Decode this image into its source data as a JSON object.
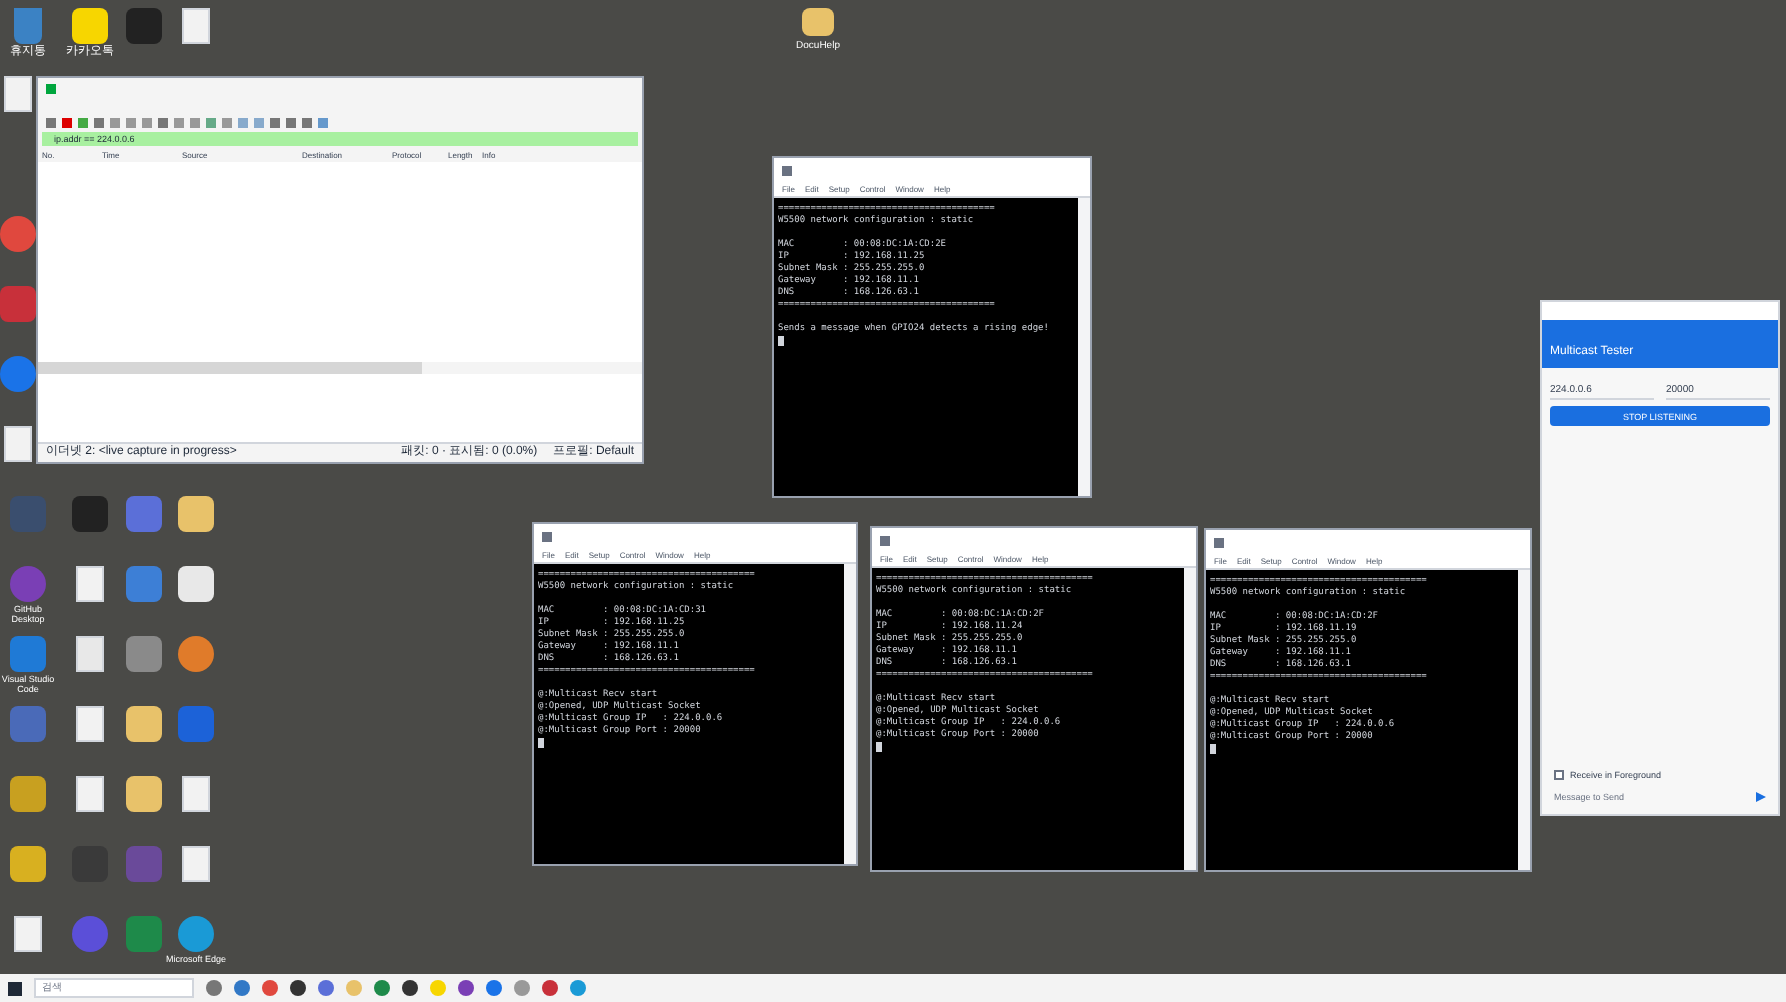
{
  "desktop_icons": [
    {
      "label": "휴지통",
      "kind": "bin",
      "color": "#3b82c4"
    },
    {
      "label": "카카오톡",
      "kind": "app",
      "color": "#f7d600"
    },
    {
      "kind": "app",
      "color": "#222222"
    },
    {
      "kind": "doc",
      "color": "#f2f2f2"
    },
    {
      "kind": "doc",
      "color": "#f2f2f2"
    },
    {
      "kind": "round",
      "color": "#e0483e"
    },
    {
      "kind": "app",
      "color": "#c8303a"
    },
    {
      "kind": "round",
      "color": "#1a73e8"
    },
    {
      "kind": "doc",
      "color": "#f2f2f2"
    },
    {
      "kind": "app",
      "color": "#3a4e6e"
    },
    {
      "kind": "app",
      "color": "#222222"
    },
    {
      "kind": "app",
      "color": "#5b6fd8"
    },
    {
      "kind": "app",
      "color": "#e8c26a"
    },
    {
      "label": "GitHub Desktop",
      "kind": "round",
      "color": "#7a3fb5"
    },
    {
      "kind": "doc",
      "color": "#f2f2f2"
    },
    {
      "kind": "app",
      "color": "#3d7fd6"
    },
    {
      "kind": "app",
      "color": "#e8e8e8"
    },
    {
      "label": "Visual Studio Code",
      "kind": "app",
      "color": "#1f7ad6"
    },
    {
      "kind": "doc",
      "color": "#e8e8e8"
    },
    {
      "kind": "app",
      "color": "#8a8a8a"
    },
    {
      "kind": "round",
      "color": "#e07b2a"
    },
    {
      "kind": "app",
      "color": "#4a6ab8"
    },
    {
      "kind": "doc",
      "color": "#f2f2f2"
    },
    {
      "kind": "app",
      "color": "#e8c26a"
    },
    {
      "kind": "app",
      "color": "#1c62d8"
    },
    {
      "kind": "app",
      "color": "#c8a020"
    },
    {
      "kind": "doc",
      "color": "#f2f2f2"
    },
    {
      "kind": "app",
      "color": "#e8c26a"
    },
    {
      "kind": "doc",
      "color": "#f2f2f2"
    },
    {
      "kind": "app",
      "color": "#d8b020"
    },
    {
      "kind": "app",
      "color": "#3a3a3a"
    },
    {
      "kind": "app",
      "color": "#6a4a9a"
    },
    {
      "kind": "doc",
      "color": "#f2f2f2"
    },
    {
      "kind": "doc",
      "color": "#f2f2f2"
    },
    {
      "kind": "round",
      "color": "#5b4fd8"
    },
    {
      "kind": "app",
      "color": "#1e8a4a"
    },
    {
      "label": "Microsoft Edge",
      "kind": "round",
      "color": "#1a9ad6"
    }
  ],
  "center_icon": {
    "label": "DocuHelp"
  },
  "wireshark": {
    "filter": "ip.addr == 224.0.0.6",
    "columns": [
      "No.",
      "Time",
      "Source",
      "Destination",
      "Protocol",
      "Length",
      "Info"
    ],
    "status_left": "이더넷 2: <live capture in progress>",
    "status_mid": "패킷: 0 · 표시됨: 0 (0.0%)",
    "status_right": "프로필: Default"
  },
  "terminals": [
    {
      "menu": [
        "File",
        "Edit",
        "Setup",
        "Control",
        "Window",
        "Help"
      ],
      "lines": [
        "========================================",
        "W5500 network configuration : static",
        "MAC         : 00:08:DC:1A:CD:2E",
        "IP          : 192.168.11.25",
        "Subnet Mask : 255.255.255.0",
        "Gateway     : 192.168.11.1",
        "DNS         : 168.126.63.1",
        "========================================",
        "Sends a message when GPIO24 detects a rising edge!"
      ]
    },
    {
      "menu": [
        "File",
        "Edit",
        "Setup",
        "Control",
        "Window",
        "Help"
      ],
      "lines": [
        "========================================",
        "W5500 network configuration : static",
        "MAC         : 00:08:DC:1A:CD:31",
        "IP          : 192.168.11.25",
        "Subnet Mask : 255.255.255.0",
        "Gateway     : 192.168.11.1",
        "DNS         : 168.126.63.1",
        "========================================",
        "@:Multicast Recv start",
        "@:Opened, UDP Multicast Socket",
        "@:Multicast Group IP   : 224.0.0.6",
        "@:Multicast Group Port : 20000"
      ]
    },
    {
      "menu": [
        "File",
        "Edit",
        "Setup",
        "Control",
        "Window",
        "Help"
      ],
      "lines": [
        "========================================",
        "W5500 network configuration : static",
        "MAC         : 00:08:DC:1A:CD:2F",
        "IP          : 192.168.11.24",
        "Subnet Mask : 255.255.255.0",
        "Gateway     : 192.168.11.1",
        "DNS         : 168.126.63.1",
        "========================================",
        "@:Multicast Recv start",
        "@:Opened, UDP Multicast Socket",
        "@:Multicast Group IP   : 224.0.0.6",
        "@:Multicast Group Port : 20000"
      ]
    },
    {
      "menu": [
        "File",
        "Edit",
        "Setup",
        "Control",
        "Window",
        "Help"
      ],
      "lines": [
        "========================================",
        "W5500 network configuration : static",
        "MAC         : 00:08:DC:1A:CD:2F",
        "IP          : 192.168.11.19",
        "Subnet Mask : 255.255.255.0",
        "Gateway     : 192.168.11.1",
        "DNS         : 168.126.63.1",
        "========================================",
        "@:Multicast Recv start",
        "@:Opened, UDP Multicast Socket",
        "@:Multicast Group IP   : 224.0.0.6",
        "@:Multicast Group Port : 20000"
      ]
    }
  ],
  "phone": {
    "app_title": "Multicast Tester",
    "group_ip": "224.0.0.6",
    "port": "20000",
    "button": "STOP LISTENING",
    "checkbox": {
      "label": "Receive in Foreground",
      "checked": false
    },
    "message_placeholder": "Message to Send"
  },
  "taskbar": {
    "search_placeholder": "검색"
  }
}
